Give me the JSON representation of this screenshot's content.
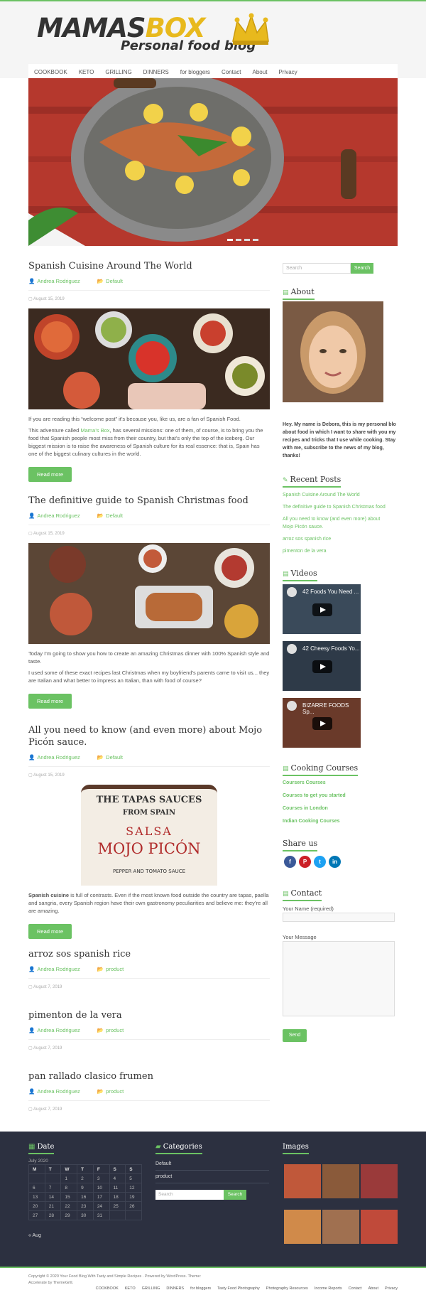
{
  "brand": {
    "logo_main": "MAMAS",
    "logo_accent": "BOX",
    "logo_sub": "Personal food blog"
  },
  "nav": {
    "items": [
      "COOKBOOK",
      "KETO",
      "GRILLING",
      "DINNERS",
      "for bloggers",
      "Contact",
      "About",
      "Privacy"
    ]
  },
  "posts": [
    {
      "title": "Spanish Cuisine Around The World",
      "author": "Andrea Rodriguez",
      "category": "Default",
      "date": "August 15, 2019",
      "p1": "If you are reading this “welcome post” it’s because you, like us, are a fan of Spanish Food.",
      "p2_a": "This adventure called ",
      "p2_link": "Mama’s Box",
      "p2_b": ", has several missions: one of them, of course, is to bring you the food that Spanish people most miss from their country, but that’s only the top of the iceberg. Our biggest mission is to raise the awareness of Spanish culture for its real essence: that is, Spain has one of the biggest culinary cultures in the world.",
      "read_more": "Read more"
    },
    {
      "title": "The definitive guide to Spanish Christmas food",
      "author": "Andrea Rodriguez",
      "category": "Default",
      "date": "August 15, 2019",
      "p1": "Today I’m going to show you how to create an amazing Christmas dinner with 100% Spanish style and taste.",
      "p2": "I used some of these exact recipes last Christmas when my boyfriend’s parents came to visit us... they are Italian and what better to impress an Italian, than with food of course?",
      "read_more": "Read more"
    },
    {
      "title": "All you need to know (and even more) about Mojo Picón sauce.",
      "author": "Andrea Rodriguez",
      "category": "Default",
      "date": "August 15, 2019",
      "jar_top": "THE TAPAS SAUCES",
      "jar_mid": "FROM SPAIN",
      "jar_salsa": "SALSA",
      "jar_name": "MOJO PICÓN",
      "jar_bottom": "PEPPER AND TOMATO SAUCE",
      "p1_bold": "Spanish cuisine",
      "p1": " is full of contrasts. Even if the most known food outside the country are tapas, paella and sangria, every Spanish region have their own gastronomy peculiarities and believe me: they’re all are amazing.",
      "read_more": "Read more"
    },
    {
      "title": "arroz sos spanish rice",
      "author": "Andrea Rodriguez",
      "category": "product",
      "date": "August 7, 2019"
    },
    {
      "title": "pimenton de la vera",
      "author": "Andrea Rodriguez",
      "category": "product",
      "date": "August 7, 2019"
    },
    {
      "title": "pan rallado clasico frumen",
      "author": "Andrea Rodriguez",
      "category": "product",
      "date": "August 7, 2019"
    }
  ],
  "sidebar": {
    "search_placeholder": "Search",
    "search_button": "Search",
    "about_title": "About",
    "about_text": "Hey. My name is Debora, this is my personal blo about food in which I want to share with you my recipes and tricks that I use while cooking. Stay with me, subscribe to the news of my blog, thanks!",
    "recent_title": "Recent Posts",
    "recent": [
      "Spanish Cuisine Around The World",
      "The definitive guide to Spanish Christmas food",
      "All you need to know (and even more) about",
      "Mojo Picón sauce.",
      "arroz sos spanish rice",
      "pimenton de la vera"
    ],
    "videos_title": "Videos",
    "videos": [
      "42 Foods You Need ...",
      "42 Cheesy Foods Yo...",
      "BIZARRE FOODS Sp..."
    ],
    "courses_title": "Cooking Courses",
    "courses": [
      "Coursers Courses",
      "Courses to get you started",
      "Courses in London",
      "Indian Cooking Courses"
    ],
    "share_title": "Share us",
    "contact_title": "Contact",
    "name_label": "Your Name (required)",
    "message_label": "Your Message",
    "send": "Send"
  },
  "footer": {
    "date_title": "Date",
    "month": "July 2020",
    "weekdays": [
      "M",
      "T",
      "W",
      "T",
      "F",
      "S",
      "S"
    ],
    "weeks": [
      [
        "",
        "",
        "1",
        "2",
        "3",
        "4",
        "5"
      ],
      [
        "6",
        "7",
        "8",
        "9",
        "10",
        "11",
        "12"
      ],
      [
        "13",
        "14",
        "15",
        "16",
        "17",
        "18",
        "19"
      ],
      [
        "20",
        "21",
        "22",
        "23",
        "24",
        "25",
        "26"
      ],
      [
        "27",
        "28",
        "29",
        "30",
        "31",
        "",
        ""
      ]
    ],
    "prev": "« Aug",
    "categories_title": "Categories",
    "categories": [
      "Default",
      "product"
    ],
    "search_placeholder": "Search",
    "search_button": "Search",
    "images_title": "Images"
  },
  "bottom": {
    "copyright": "Copyright © 2020 Your Food Blog With Tasty and Simple Recipes . Powered by WordPress. Theme:",
    "theme": "Accelerate by ThemeGrill.",
    "nav": [
      "COOKBOOK",
      "KETO",
      "GRILLING",
      "DINNERS",
      "for bloggers",
      "Tasty Food Photography",
      "Photography Resources",
      "Income Reports",
      "Contact",
      "About",
      "Privacy"
    ]
  }
}
